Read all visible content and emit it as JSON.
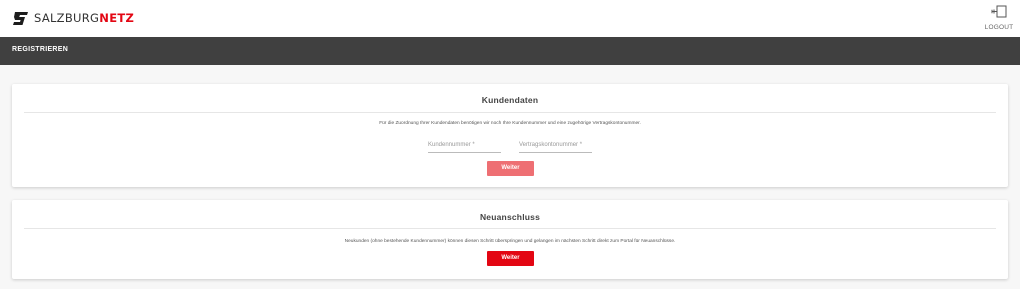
{
  "header": {
    "logo_prefix": "SALZBURG",
    "logo_accent": "NETZ",
    "logout_label": "LOGOUT"
  },
  "nav": {
    "item_label": "REGISTRIEREN"
  },
  "kundendaten": {
    "title": "Kundendaten",
    "description": "Für die Zuordnung Ihrer Kundendaten benötigen wir noch Ihre Kundennummer und eine zugehörige Vertragskontonummer.",
    "kundennummer_placeholder": "Kundennummer *",
    "vertragskonto_placeholder": "Vertragskontonummer *",
    "button_label": "Weiter"
  },
  "neuanschluss": {
    "title": "Neuanschluss",
    "description": "Neukunden (ohne bestehende Kundennummer) können diesen Schritt überspringen und gelangen im nächsten Schritt direkt zum Portal für Neuanschlüsse.",
    "button_label": "Weiter"
  },
  "colors": {
    "brand_red": "#e30613",
    "button_disabled": "#ee6f73",
    "navbar_bg": "#404040"
  },
  "icons": {
    "logo": "salzburgnetz-logo-icon",
    "logout": "logout-plug-icon"
  }
}
